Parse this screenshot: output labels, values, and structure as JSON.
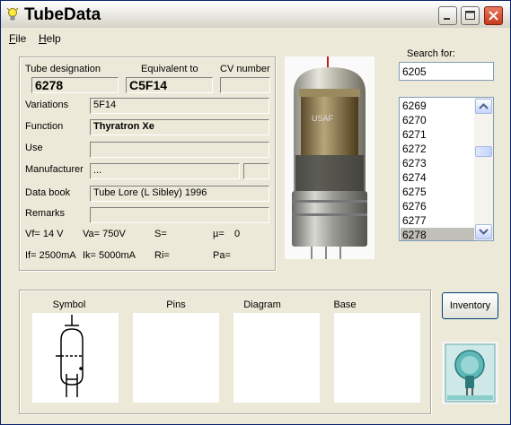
{
  "app": {
    "title": "TubeData"
  },
  "menu": {
    "file": "File",
    "help": "Help"
  },
  "details": {
    "tube_designation_label": "Tube designation",
    "tube_designation": "6278",
    "equivalent_label": "Equivalent to",
    "equivalent": "C5F14",
    "cv_label": "CV number",
    "cv": "",
    "variations_label": "Variations",
    "variations": "5F14",
    "function_label": "Function",
    "function": "Thyratron Xe",
    "use_label": "Use",
    "use": "",
    "manufacturer_label": "Manufacturer",
    "manufacturer": "...",
    "manufacturer_code": "",
    "databook_label": "Data book",
    "databook": "Tube Lore (L Sibley) 1996",
    "remarks_label": "Remarks",
    "remarks": "",
    "vf": "Vf= 14 V",
    "va": "Va= 750V",
    "s": "S=",
    "mu": "µ=",
    "mu_value": "0",
    "if": "If= 2500mA",
    "ik": "Ik= 5000mA",
    "ri": "Ri=",
    "pa": "Pa="
  },
  "search": {
    "label": "Search for:",
    "value": "6205",
    "results": [
      "6269",
      "6270",
      "6271",
      "6272",
      "6273",
      "6274",
      "6275",
      "6276",
      "6277",
      "6278"
    ],
    "selected": "6278"
  },
  "panels": {
    "symbol": "Symbol",
    "pins": "Pins",
    "diagram": "Diagram",
    "base": "Base"
  },
  "buttons": {
    "inventory": "Inventory"
  },
  "photo": {
    "label_text": "USAF"
  }
}
